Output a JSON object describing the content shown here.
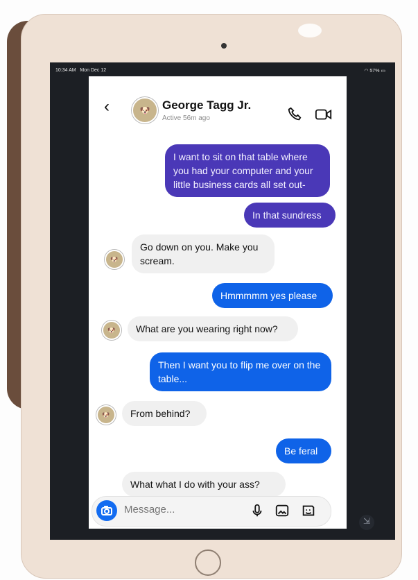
{
  "status_bar": {
    "time": "10:34 AM",
    "date": "Mon Dec 12",
    "battery": "57%"
  },
  "header": {
    "contact_name": "George Tagg Jr.",
    "active_status": "Active 56m ago",
    "back_icon": "chevron-left-icon",
    "call_icon": "phone-icon",
    "video_icon": "video-camera-icon"
  },
  "messages": [
    {
      "type": "sent",
      "color": "#4a38b7",
      "text": "I want to sit on that table where you had your computer and your little business cards all set out-"
    },
    {
      "type": "sent",
      "color": "#4a38b7",
      "text": "In that sundress"
    },
    {
      "type": "received",
      "text": "Go down on you. Make you scream."
    },
    {
      "type": "sent",
      "color": "#0f63e8",
      "text": "Hmmmmm yes please"
    },
    {
      "type": "received",
      "text": "What are you wearing right now?"
    },
    {
      "type": "sent",
      "color": "#0f63e8",
      "text": "Then I want you to flip me over on the table..."
    },
    {
      "type": "received",
      "text": "From behind?"
    },
    {
      "type": "sent",
      "color": "#0f63e8",
      "text": "Be feral"
    },
    {
      "type": "received",
      "text": "What what I do with your ass?"
    }
  ],
  "composer": {
    "placeholder": "Message...",
    "camera_icon": "camera-icon",
    "mic_icon": "microphone-icon",
    "gallery_icon": "image-icon",
    "sticker_icon": "sticker-icon"
  },
  "device": {
    "corner_icon": "collapse-icon"
  }
}
